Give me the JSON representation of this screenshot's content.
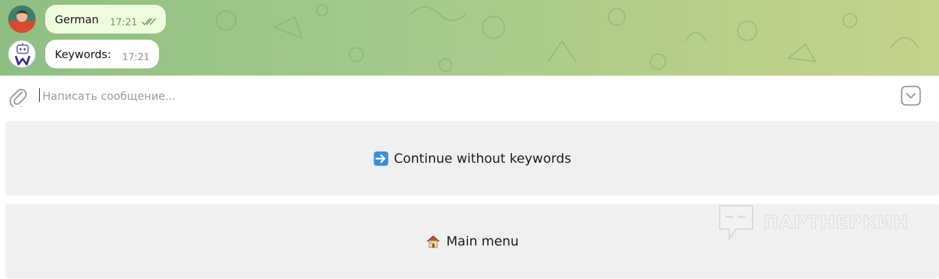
{
  "messages": [
    {
      "sender": "user",
      "text": "German",
      "time": "17:21",
      "read": true
    },
    {
      "sender": "bot",
      "text": "Keywords:",
      "time": "17:21"
    }
  ],
  "composer": {
    "placeholder": "Написать сообщение..."
  },
  "keyboard": {
    "buttons": [
      {
        "emoji_icon": "right-arrow-emoji",
        "label": "Continue without keywords"
      },
      {
        "emoji_icon": "house-emoji",
        "label": "Main menu"
      }
    ]
  },
  "watermark": {
    "text": "ПАРТНЕРКИН"
  },
  "colors": {
    "outgoing_bubble": "#effdde",
    "incoming_bubble": "#ffffff",
    "read_ticks": "#5ea84f",
    "keyboard_button": "#f0f0f0"
  }
}
